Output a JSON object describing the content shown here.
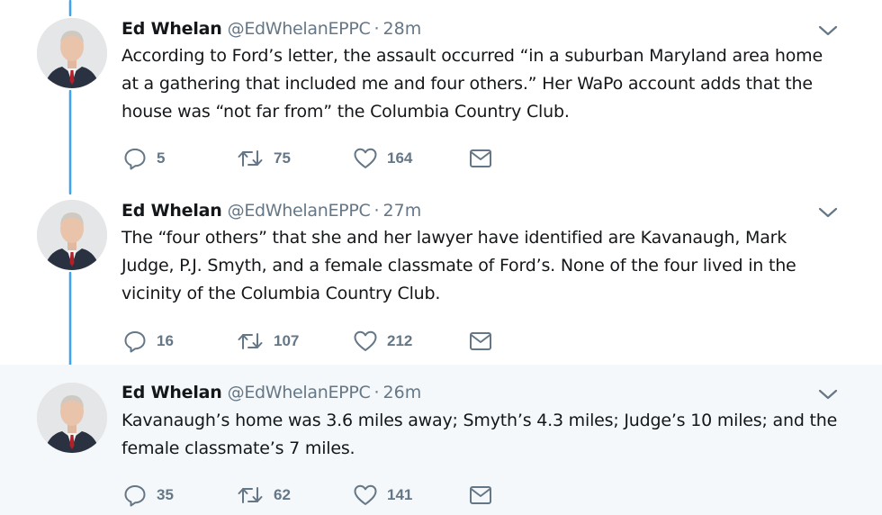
{
  "tweets": [
    {
      "name": "Ed Whelan",
      "handle": "@EdWhelanEPPC",
      "separator": "·",
      "time": "28m",
      "text": "According to Ford’s letter, the assault occurred “in a suburban Maryland area home at a gathering that included me and four others.” Her WaPo account adds that the house was “not far from” the Columbia Country Club.",
      "replies": "5",
      "retweets": "75",
      "likes": "164"
    },
    {
      "name": "Ed Whelan",
      "handle": "@EdWhelanEPPC",
      "separator": "·",
      "time": "27m",
      "text": "The “four others” that she and her lawyer have identified are Kavanaugh, Mark Judge, P.J. Smyth, and a female classmate of Ford’s. None of the four lived in the vicinity of the Columbia Country Club.",
      "replies": "16",
      "retweets": "107",
      "likes": "212"
    },
    {
      "name": "Ed Whelan",
      "handle": "@EdWhelanEPPC",
      "separator": "·",
      "time": "26m",
      "text": "Kavanaugh’s home was 3.6 miles away; Smyth’s 4.3 miles; Judge’s 10 miles; and the female classmate’s 7 miles.",
      "replies": "35",
      "retweets": "62",
      "likes": "141"
    }
  ],
  "icons": {
    "reply": "reply-icon",
    "retweet": "retweet-icon",
    "like": "heart-icon",
    "message": "envelope-icon",
    "caret": "chevron-down-icon"
  },
  "colors": {
    "thread_line": "#3ea3f0",
    "secondary_text": "#657786",
    "highlight_background": "#f5f8fa"
  }
}
